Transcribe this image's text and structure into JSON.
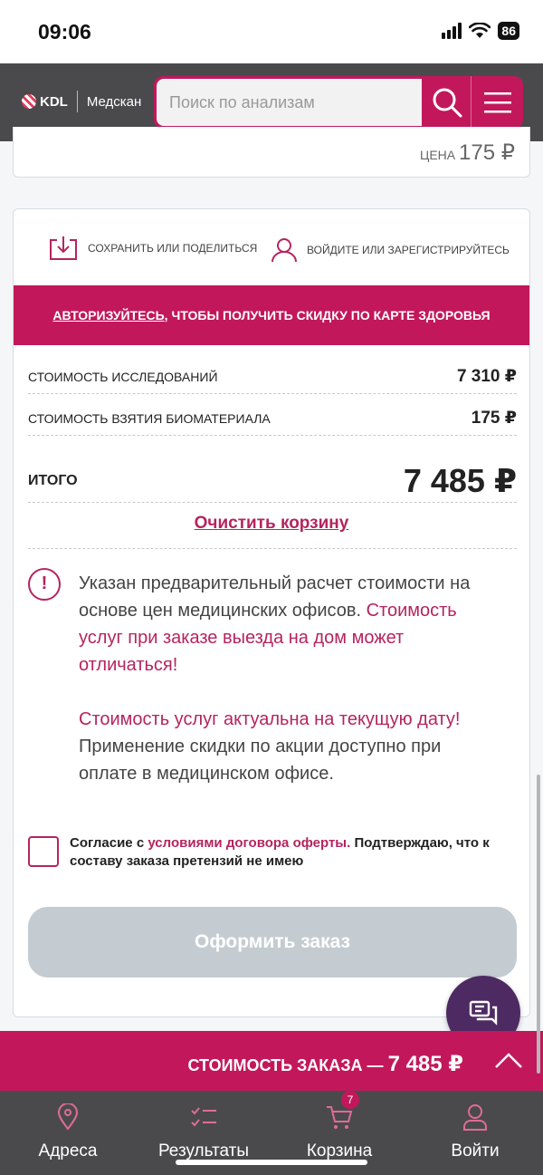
{
  "status_bar": {
    "time": "09:06",
    "battery": "86"
  },
  "header": {
    "logo_kdl": "KDL",
    "logo_medscan": "Медскан",
    "search_placeholder": "Поиск по анализам"
  },
  "prev_item": {
    "price_label": "ЦЕНА",
    "price_value": "175 ₽"
  },
  "actions": {
    "save_share": "СОХРАНИТЬ ИЛИ ПОДЕЛИТЬСЯ",
    "login_register": "ВОЙДИТЕ ИЛИ ЗАРЕГИСТРИРУЙТЕСЬ"
  },
  "promo": {
    "link": "АВТОРИЗУЙТЕСЬ",
    "text": ", ЧТОБЫ ПОЛУЧИТЬ СКИДКУ ПО КАРТЕ ЗДОРОВЬЯ"
  },
  "summary": {
    "research_label": "СТОИМОСТЬ ИССЛЕДОВАНИЙ",
    "research_value": "7 310 ₽",
    "biomaterial_label": "СТОИМОСТЬ ВЗЯТИЯ БИОМАТЕРИАЛА",
    "biomaterial_value": "175 ₽",
    "total_label": "ИТОГО",
    "total_value": "7 485 ₽"
  },
  "clear_cart": "Очистить корзину",
  "notice": {
    "part1": "Указан предварительный расчет стоимости на основе цен медицинских офисов. ",
    "part2_pink": "Стоимость услуг при заказе выезда на дом может отличаться!",
    "part3_pink": "Стоимость услуг актуальна на текущую дату!",
    "part4": "  Применение скидки по акции доступно при оплате в медицинском офисе."
  },
  "consent": {
    "prefix": "Согласие с ",
    "link": "условиями договора оферты.",
    "suffix": " Подтверждаю, что к составу заказа претензий не имею"
  },
  "order_button": "Оформить заказ",
  "total_bar": {
    "label": "СТОИМОСТЬ ЗАКАЗА — ",
    "amount": "7 485 ₽"
  },
  "nav": {
    "addresses": "Адреса",
    "results": "Результаты",
    "cart": "Корзина",
    "cart_badge": "7",
    "login": "Войти"
  },
  "colors": {
    "brand": "#c2185b",
    "header": "#4a4a4c",
    "chat": "#4e2a63",
    "disabled_button": "#c5ccd1"
  }
}
